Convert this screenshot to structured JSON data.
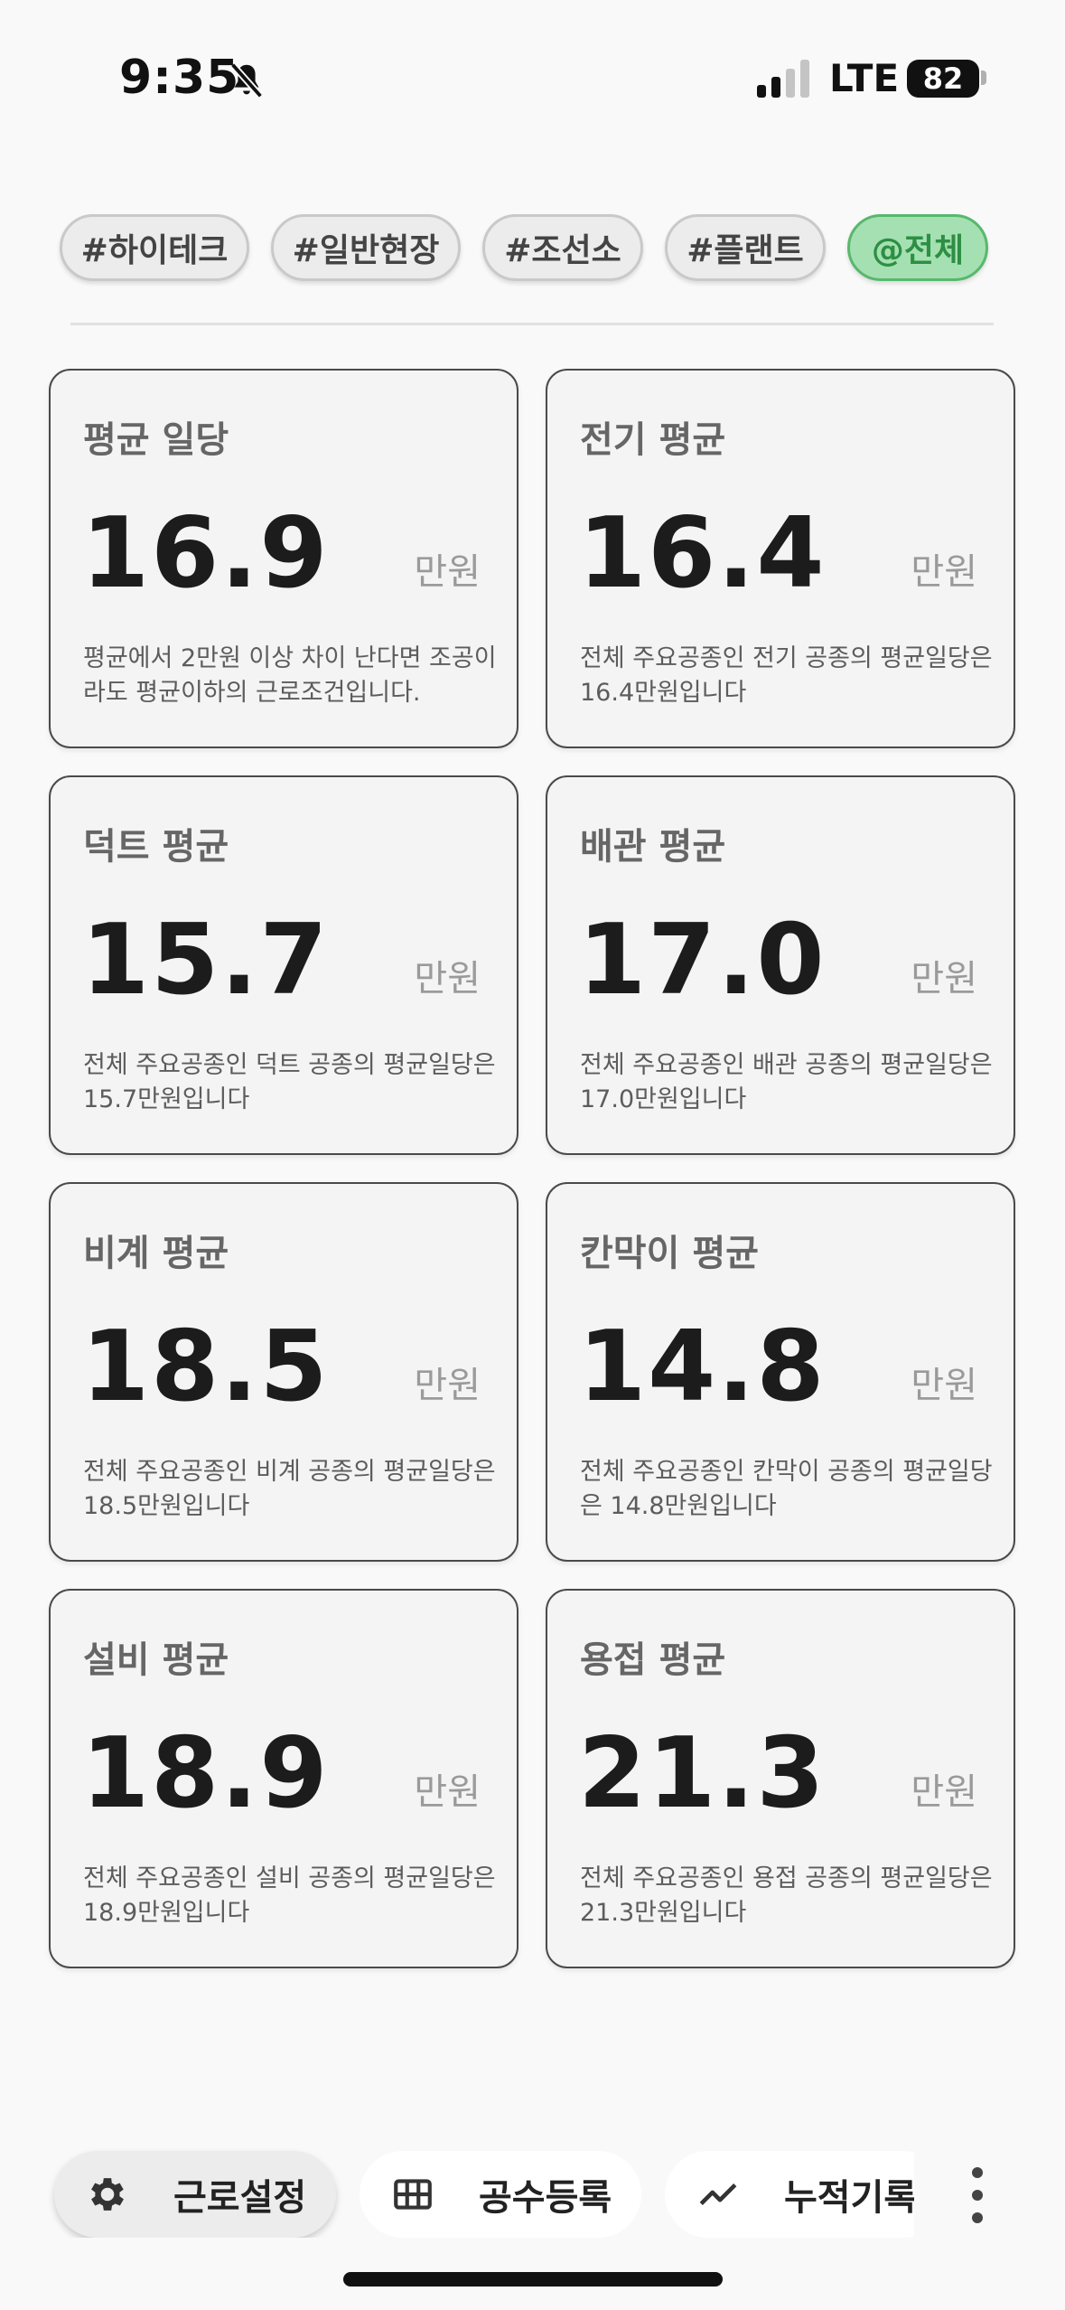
{
  "status_bar": {
    "time": "9:35",
    "network": "LTE",
    "battery": "82"
  },
  "chips": [
    {
      "label": "#하이테크",
      "active": false
    },
    {
      "label": "#일반현장",
      "active": false
    },
    {
      "label": "#조선소",
      "active": false
    },
    {
      "label": "#플랜트",
      "active": false
    },
    {
      "label": "@전체",
      "active": true
    }
  ],
  "cards": [
    {
      "title": "평균 일당",
      "value": "16.9",
      "unit": "만원",
      "desc": "평균에서 2만원 이상 차이 난다면 조공이라도 평균이하의 근로조건입니다."
    },
    {
      "title": "전기 평균",
      "value": "16.4",
      "unit": "만원",
      "desc": "전체 주요공종인 전기 공종의 평균일당은 16.4만원입니다"
    },
    {
      "title": "덕트 평균",
      "value": "15.7",
      "unit": "만원",
      "desc": "전체 주요공종인 덕트 공종의 평균일당은 15.7만원입니다"
    },
    {
      "title": "배관 평균",
      "value": "17.0",
      "unit": "만원",
      "desc": "전체 주요공종인 배관 공종의 평균일당은 17.0만원입니다"
    },
    {
      "title": "비계 평균",
      "value": "18.5",
      "unit": "만원",
      "desc": "전체 주요공종인 비계 공종의 평균일당은 18.5만원입니다"
    },
    {
      "title": "칸막이 평균",
      "value": "14.8",
      "unit": "만원",
      "desc": "전체 주요공종인 칸막이 공종의 평균일당은 14.8만원입니다"
    },
    {
      "title": "설비 평균",
      "value": "18.9",
      "unit": "만원",
      "desc": "전체 주요공종인 설비 공종의 평균일당은 18.9만원입니다"
    },
    {
      "title": "용접 평균",
      "value": "21.3",
      "unit": "만원",
      "desc": "전체 주요공종인 용접 공종의 평균일당은 21.3만원입니다"
    }
  ],
  "bottom_nav": [
    {
      "label": "근로설정",
      "icon": "gear-icon",
      "selected": true
    },
    {
      "label": "공수등록",
      "icon": "grid-icon",
      "selected": false
    },
    {
      "label": "누적기록",
      "icon": "trend-icon",
      "selected": false
    }
  ],
  "colors": {
    "active_chip_bg": "#a5e0b3",
    "active_chip_text": "#2d8f43",
    "card_border": "#4a4a4a"
  }
}
